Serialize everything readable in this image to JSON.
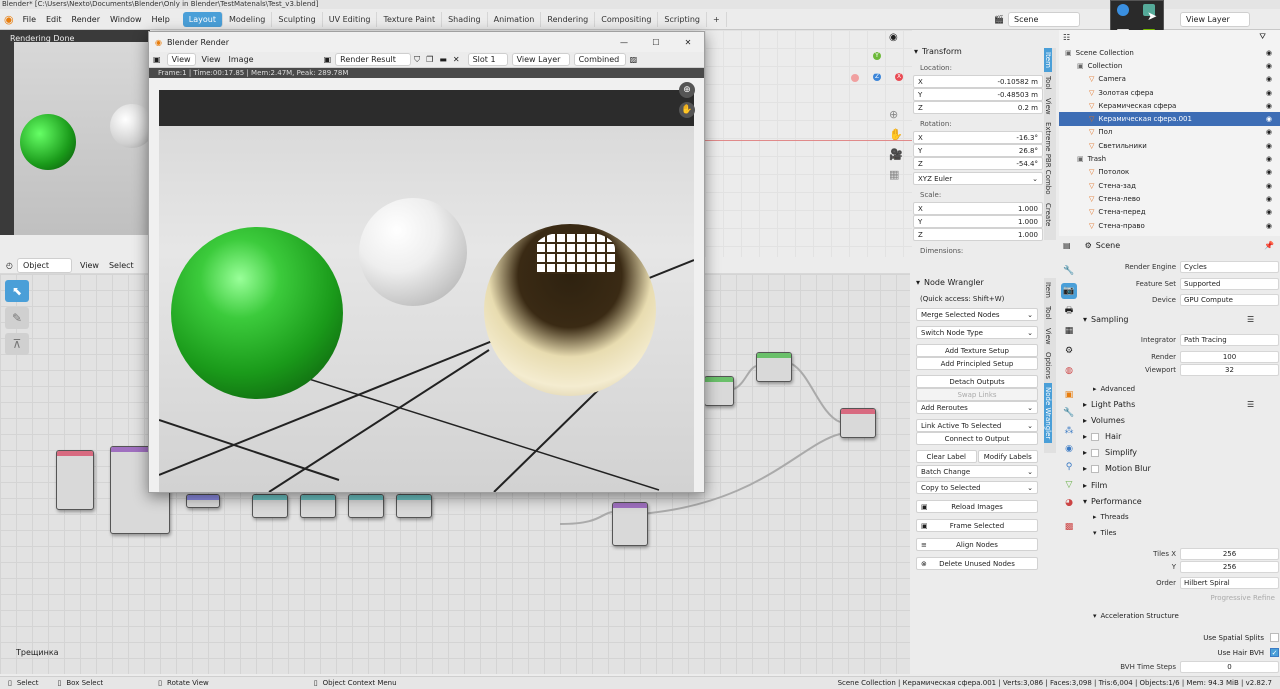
{
  "window_title": "Blender* [C:\\Users\\Nexto\\Documents\\Blender\\Only in Blender\\TestMatenals\\Test_v3.blend]",
  "menu": [
    "File",
    "Edit",
    "Render",
    "Window",
    "Help"
  ],
  "workspaces": [
    "Layout",
    "Modeling",
    "Sculpting",
    "UV Editing",
    "Texture Paint",
    "Shading",
    "Animation",
    "Rendering",
    "Compositing",
    "Scripting"
  ],
  "active_workspace": "Layout",
  "add_tab": "+",
  "scene_name": "Scene",
  "view_layer": "View Layer",
  "viewport_status": "Rendering Done",
  "node_header": {
    "mode": "Object",
    "view": "View",
    "select": "Select"
  },
  "node_editor_label": "Трещинка",
  "render_window": {
    "title": "Blender Render",
    "view_menu": "View",
    "view2": "View",
    "image": "Image",
    "render_result": "Render Result",
    "slot": "Slot 1",
    "view_layer": "View Layer",
    "pass": "Combined",
    "info": "Frame:1 | Time:00:17.85 | Mem:2.47M, Peak: 289.78M",
    "min": "—",
    "max": "☐",
    "close": "✕"
  },
  "transform": {
    "header": "Transform",
    "location_label": "Location:",
    "location": [
      {
        "axis": "X",
        "value": "-0.10582 m"
      },
      {
        "axis": "Y",
        "value": "-0.48503 m"
      },
      {
        "axis": "Z",
        "value": "0.2 m"
      }
    ],
    "rotation_label": "Rotation:",
    "rotation": [
      {
        "axis": "X",
        "value": "-16.3°"
      },
      {
        "axis": "Y",
        "value": "26.8°"
      },
      {
        "axis": "Z",
        "value": "-54.4°"
      }
    ],
    "rotation_mode": "XYZ Euler",
    "scale_label": "Scale:",
    "scale": [
      {
        "axis": "X",
        "value": "1.000"
      },
      {
        "axis": "Y",
        "value": "1.000"
      },
      {
        "axis": "Z",
        "value": "1.000"
      }
    ],
    "dimensions_label": "Dimensions:"
  },
  "upper_vtabs": [
    "Item",
    "Tool",
    "View",
    "Extreme PBR Combo",
    "Create"
  ],
  "lower_vtabs": [
    "Item",
    "Tool",
    "View",
    "Options",
    "Node Wrangler"
  ],
  "node_wrangler": {
    "header": "Node Wrangler",
    "quick": "(Quick access: Shift+W)",
    "merge": "Merge Selected Nodes",
    "switch": "Switch Node Type",
    "add_texture": "Add Texture Setup",
    "add_principled": "Add Principled Setup",
    "detach": "Detach Outputs",
    "swap": "Swap Links",
    "reroutes": "Add Reroutes",
    "link_active": "Link Active To Selected",
    "connect": "Connect to Output",
    "clear_label": "Clear Label",
    "modify_labels": "Modify Labels",
    "batch": "Batch Change",
    "copy": "Copy to Selected",
    "reload": "Reload Images",
    "frame": "Frame Selected",
    "align": "Align Nodes",
    "delete_unused": "Delete Unused Nodes"
  },
  "outliner": {
    "items": [
      {
        "label": "Scene Collection",
        "indent": 0
      },
      {
        "label": "Collection",
        "indent": 1
      },
      {
        "label": "Camera",
        "indent": 2
      },
      {
        "label": "Золотая сфера",
        "indent": 2
      },
      {
        "label": "Керамическая сфера",
        "indent": 2
      },
      {
        "label": "Керамическая сфера.001",
        "indent": 2,
        "selected": true
      },
      {
        "label": "Пол",
        "indent": 2
      },
      {
        "label": "Светильники",
        "indent": 2
      },
      {
        "label": "Trash",
        "indent": 1
      },
      {
        "label": "Потолок",
        "indent": 2
      },
      {
        "label": "Стена-зад",
        "indent": 2
      },
      {
        "label": "Стена-лево",
        "indent": 2
      },
      {
        "label": "Стена-перед",
        "indent": 2
      },
      {
        "label": "Стена-право",
        "indent": 2
      }
    ]
  },
  "properties": {
    "scene": "Scene",
    "render_engine_label": "Render Engine",
    "render_engine": "Cycles",
    "feature_set_label": "Feature Set",
    "feature_set": "Supported",
    "device_label": "Device",
    "device": "GPU Compute",
    "sampling": "Sampling",
    "integrator_label": "Integrator",
    "integrator": "Path Tracing",
    "render_label": "Render",
    "render_samples": "100",
    "viewport_label": "Viewport",
    "viewport_samples": "32",
    "advanced": "Advanced",
    "light_paths": "Light Paths",
    "volumes": "Volumes",
    "hair": "Hair",
    "simplify": "Simplify",
    "motion_blur": "Motion Blur",
    "film": "Film",
    "performance": "Performance",
    "threads": "Threads",
    "tiles": "Tiles",
    "tiles_x_label": "Tiles X",
    "tiles_x": "256",
    "tiles_y_label": "Y",
    "tiles_y": "256",
    "order_label": "Order",
    "order": "Hilbert Spiral",
    "progressive_refine": "Progressive Refine",
    "accel": "Acceleration Structure",
    "spatial_splits": "Use Spatial Splits",
    "hair_bvh": "Use Hair BVH",
    "bvh_steps_label": "BVH Time Steps",
    "bvh_steps": "0"
  },
  "status": {
    "select": "Select",
    "box_select": "Box Select",
    "rotate": "Rotate View",
    "context": "Object Context Menu",
    "stats": "Scene Collection | Керамическая сфера.001 | Verts:3,086 | Faces:3,098 | Tris:6,004 | Objects:1/6 | Mem: 94.3 MiB | v2.82.7"
  },
  "colors": {
    "accent": "#4a9fd8",
    "selected": "#3d6db5",
    "green_sphere": "#1fb51f"
  }
}
